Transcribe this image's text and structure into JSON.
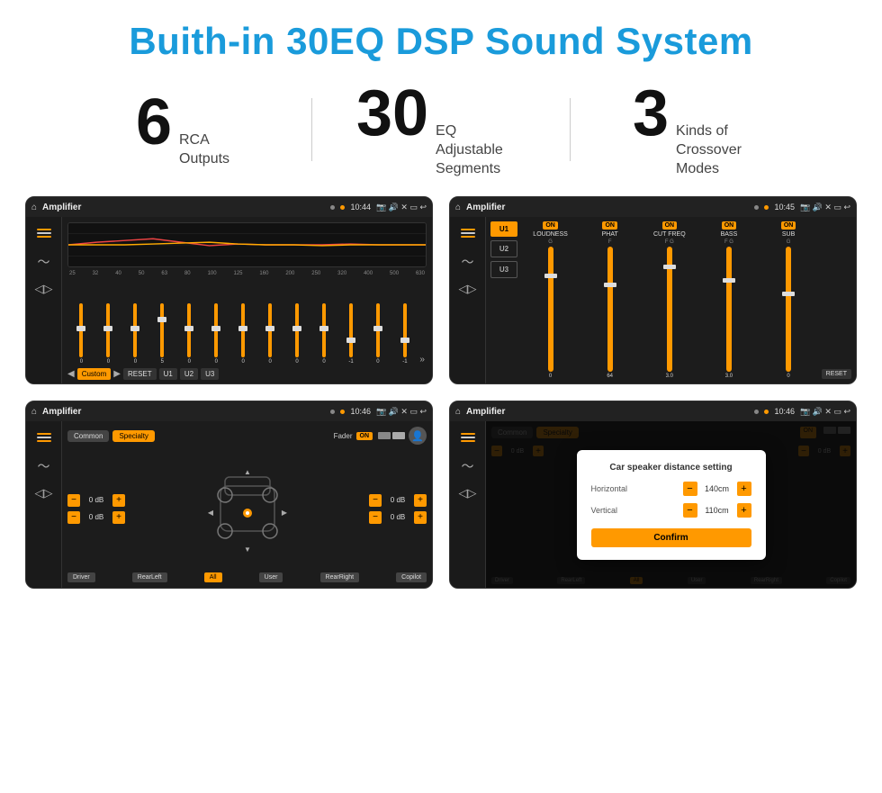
{
  "header": {
    "title": "Buith-in 30EQ DSP Sound System"
  },
  "stats": [
    {
      "number": "6",
      "desc_line1": "RCA",
      "desc_line2": "Outputs"
    },
    {
      "number": "30",
      "desc_line1": "EQ Adjustable",
      "desc_line2": "Segments"
    },
    {
      "number": "3",
      "desc_line1": "Kinds of",
      "desc_line2": "Crossover Modes"
    }
  ],
  "screens": {
    "eq_screen": {
      "topbar": {
        "title": "Amplifier",
        "time": "10:44"
      },
      "freq_labels": [
        "25",
        "32",
        "40",
        "50",
        "63",
        "80",
        "100",
        "125",
        "160",
        "200",
        "250",
        "320",
        "400",
        "500",
        "630"
      ],
      "slider_values": [
        "0",
        "0",
        "0",
        "5",
        "0",
        "0",
        "0",
        "0",
        "0",
        "0",
        "-1",
        "0",
        "-1"
      ],
      "buttons": [
        "Custom",
        "RESET",
        "U1",
        "U2",
        "U3"
      ]
    },
    "crossover_screen": {
      "topbar": {
        "title": "Amplifier",
        "time": "10:45"
      },
      "presets": [
        "U1",
        "U2",
        "U3"
      ],
      "channels": [
        {
          "on": true,
          "name": "LOUDNESS"
        },
        {
          "on": true,
          "name": "PHAT"
        },
        {
          "on": true,
          "name": "CUT FREQ"
        },
        {
          "on": true,
          "name": "BASS"
        },
        {
          "on": true,
          "name": "SUB"
        }
      ],
      "reset_label": "RESET"
    },
    "fader_screen": {
      "topbar": {
        "title": "Amplifier",
        "time": "10:46"
      },
      "tabs": [
        "Common",
        "Specialty"
      ],
      "fader_label": "Fader",
      "fader_on": "ON",
      "db_values": [
        "0 dB",
        "0 dB",
        "0 dB",
        "0 dB"
      ],
      "bottom_buttons": [
        "Driver",
        "RearLeft",
        "All",
        "User",
        "RearRight",
        "Copilot"
      ]
    },
    "distance_screen": {
      "topbar": {
        "title": "Amplifier",
        "time": "10:46"
      },
      "tabs": [
        "Common",
        "Specialty"
      ],
      "dialog": {
        "title": "Car speaker distance setting",
        "horizontal_label": "Horizontal",
        "horizontal_value": "140cm",
        "vertical_label": "Vertical",
        "vertical_value": "110cm",
        "confirm_label": "Confirm"
      },
      "db_values": [
        "0 dB",
        "0 dB"
      ],
      "bottom_buttons": [
        "Driver",
        "RearLeft",
        "All",
        "User",
        "RearRight",
        "Copilot"
      ]
    }
  }
}
